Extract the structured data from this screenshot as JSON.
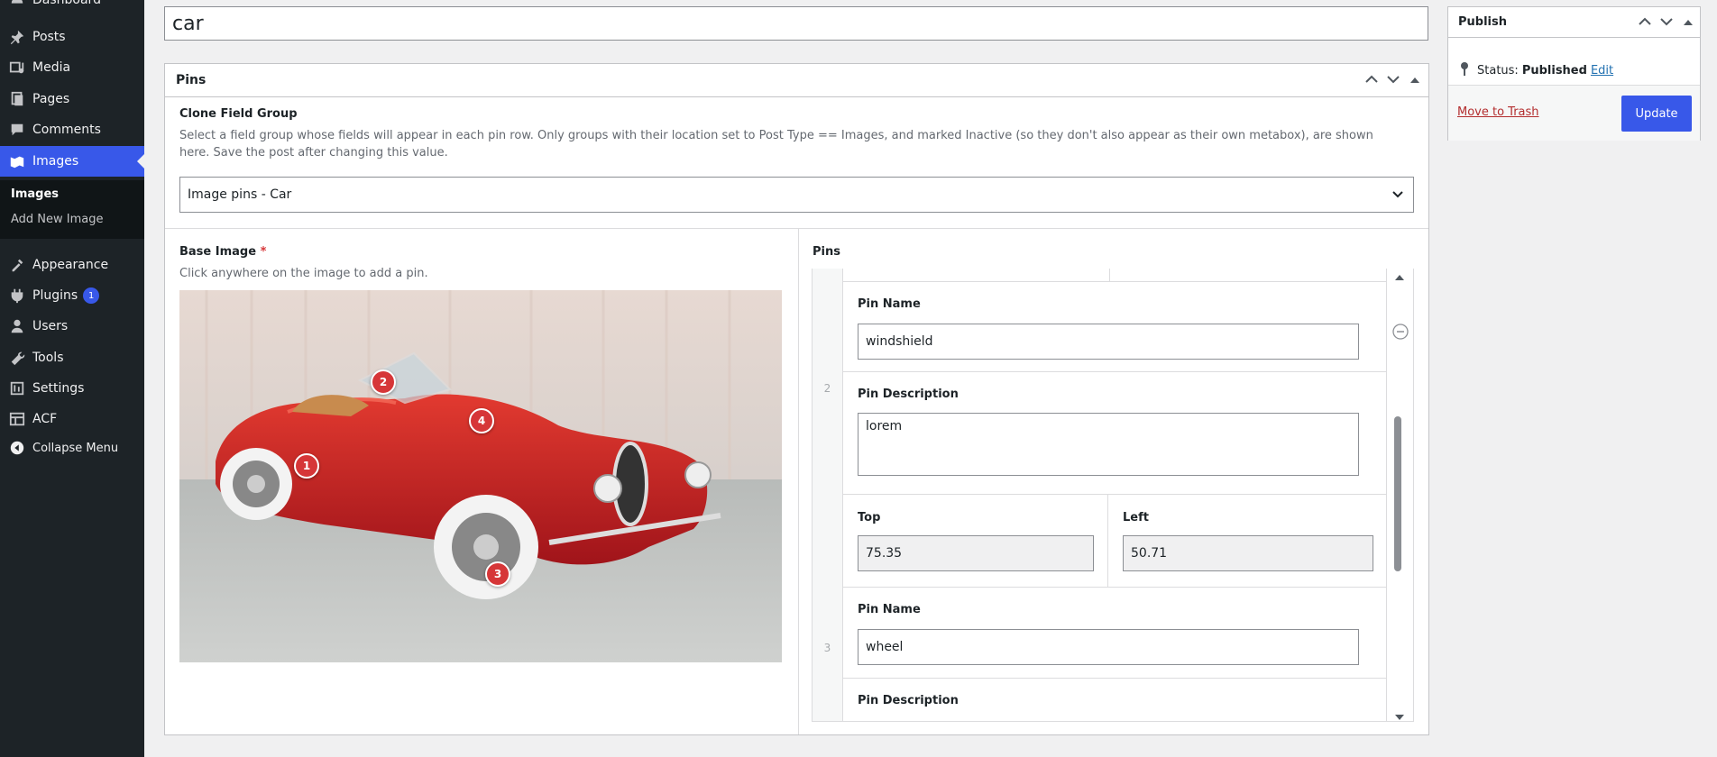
{
  "sidebar": {
    "items": [
      {
        "label": "Dashboard",
        "icon": "dashboard-icon"
      },
      {
        "label": "Posts",
        "icon": "pin-icon"
      },
      {
        "label": "Media",
        "icon": "media-icon"
      },
      {
        "label": "Pages",
        "icon": "pages-icon"
      },
      {
        "label": "Comments",
        "icon": "comments-icon"
      },
      {
        "label": "Images",
        "icon": "images-icon"
      },
      {
        "label": "Appearance",
        "icon": "appearance-icon"
      },
      {
        "label": "Plugins",
        "icon": "plugins-icon",
        "badge": "1"
      },
      {
        "label": "Users",
        "icon": "users-icon"
      },
      {
        "label": "Tools",
        "icon": "tools-icon"
      },
      {
        "label": "Settings",
        "icon": "settings-icon"
      },
      {
        "label": "ACF",
        "icon": "acf-icon"
      },
      {
        "label": "Collapse Menu",
        "icon": "collapse-icon"
      }
    ],
    "submenu": [
      "Images",
      "Add New Image"
    ]
  },
  "title": {
    "value": "car"
  },
  "pins_box": {
    "title": "Pins",
    "clone_group": {
      "label": "Clone Field Group",
      "description": "Select a field group whose fields will appear in each pin row. Only groups with their location set to Post Type == Images, and marked Inactive (so they don't also appear as their own metabox), are shown here. Save the post after changing this value.",
      "selected": "Image pins - Car"
    },
    "base_image": {
      "label": "Base Image",
      "required_mark": "*",
      "description": "Click anywhere on the image to add a pin.",
      "pins": [
        "1",
        "2",
        "3",
        "4"
      ]
    },
    "repeater": {
      "label": "Pins",
      "rows": [
        {
          "num": "2",
          "pin_name_label": "Pin Name",
          "pin_name": "windshield",
          "pin_desc_label": "Pin Description",
          "pin_desc": "lorem"
        },
        {
          "num": "3",
          "top_label": "Top",
          "top": "75.35",
          "left_label": "Left",
          "left": "50.71",
          "pin_name_label": "Pin Name",
          "pin_name": "wheel",
          "pin_desc_label": "Pin Description"
        }
      ]
    }
  },
  "publish": {
    "title": "Publish",
    "status_label": "Status:",
    "status_value": "Published",
    "edit_link": "Edit",
    "trash_link": "Move to Trash",
    "update_button": "Update"
  },
  "colors": {
    "accent": "#3858e9",
    "pin": "#d63638",
    "sidebar": "#1d2327"
  }
}
